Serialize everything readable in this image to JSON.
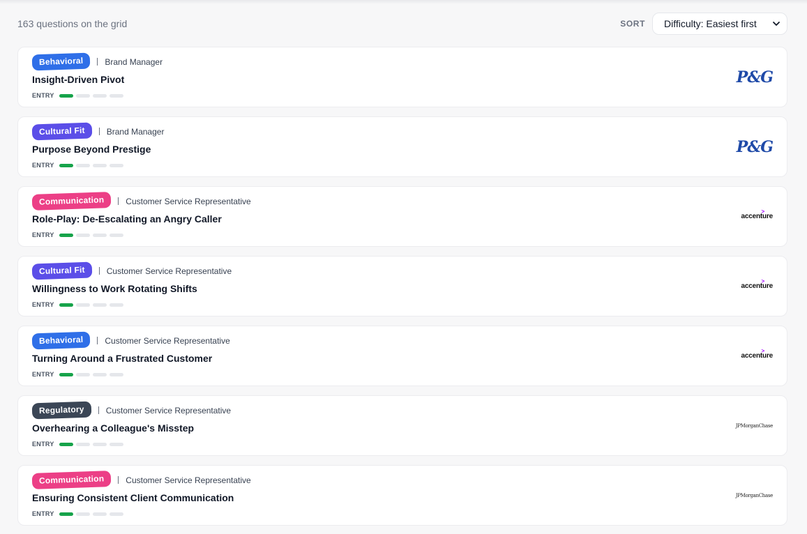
{
  "header": {
    "count_text": "163 questions on the grid",
    "sort_label": "SORT",
    "sort_value": "Difficulty: Easiest first"
  },
  "colors": {
    "behavioral": "#2f6fe8",
    "cultural_fit": "#5b4ee8",
    "communication": "#ec3f86",
    "regulatory": "#3b4656",
    "difficulty_on": "#16a34a"
  },
  "cards": [
    {
      "tag": "Behavioral",
      "tag_color": "#2f6fe8",
      "role": "Brand Manager",
      "title": "Insight-Driven Pivot",
      "level": "ENTRY",
      "difficulty": 1,
      "difficulty_max": 4,
      "company_logo": "P&G",
      "logo_style": "pg"
    },
    {
      "tag": "Cultural Fit",
      "tag_color": "#5b4ee8",
      "role": "Brand Manager",
      "title": "Purpose Beyond Prestige",
      "level": "ENTRY",
      "difficulty": 1,
      "difficulty_max": 4,
      "company_logo": "P&G",
      "logo_style": "pg"
    },
    {
      "tag": "Communication",
      "tag_color": "#ec3f86",
      "role": "Customer Service Representative",
      "title": "Role-Play: De-Escalating an Angry Caller",
      "level": "ENTRY",
      "difficulty": 1,
      "difficulty_max": 4,
      "company_logo": "accenture",
      "logo_style": "acc"
    },
    {
      "tag": "Cultural Fit",
      "tag_color": "#5b4ee8",
      "role": "Customer Service Representative",
      "title": "Willingness to Work Rotating Shifts",
      "level": "ENTRY",
      "difficulty": 1,
      "difficulty_max": 4,
      "company_logo": "accenture",
      "logo_style": "acc"
    },
    {
      "tag": "Behavioral",
      "tag_color": "#2f6fe8",
      "role": "Customer Service Representative",
      "title": "Turning Around a Frustrated Customer",
      "level": "ENTRY",
      "difficulty": 1,
      "difficulty_max": 4,
      "company_logo": "accenture",
      "logo_style": "acc"
    },
    {
      "tag": "Regulatory",
      "tag_color": "#3b4656",
      "role": "Customer Service Representative",
      "title": "Overhearing a Colleague's Misstep",
      "level": "ENTRY",
      "difficulty": 1,
      "difficulty_max": 4,
      "company_logo": "JPMorganChase",
      "logo_style": "jpm"
    },
    {
      "tag": "Communication",
      "tag_color": "#ec3f86",
      "role": "Customer Service Representative",
      "title": "Ensuring Consistent Client Communication",
      "level": "ENTRY",
      "difficulty": 1,
      "difficulty_max": 4,
      "company_logo": "JPMorganChase",
      "logo_style": "jpm"
    }
  ]
}
